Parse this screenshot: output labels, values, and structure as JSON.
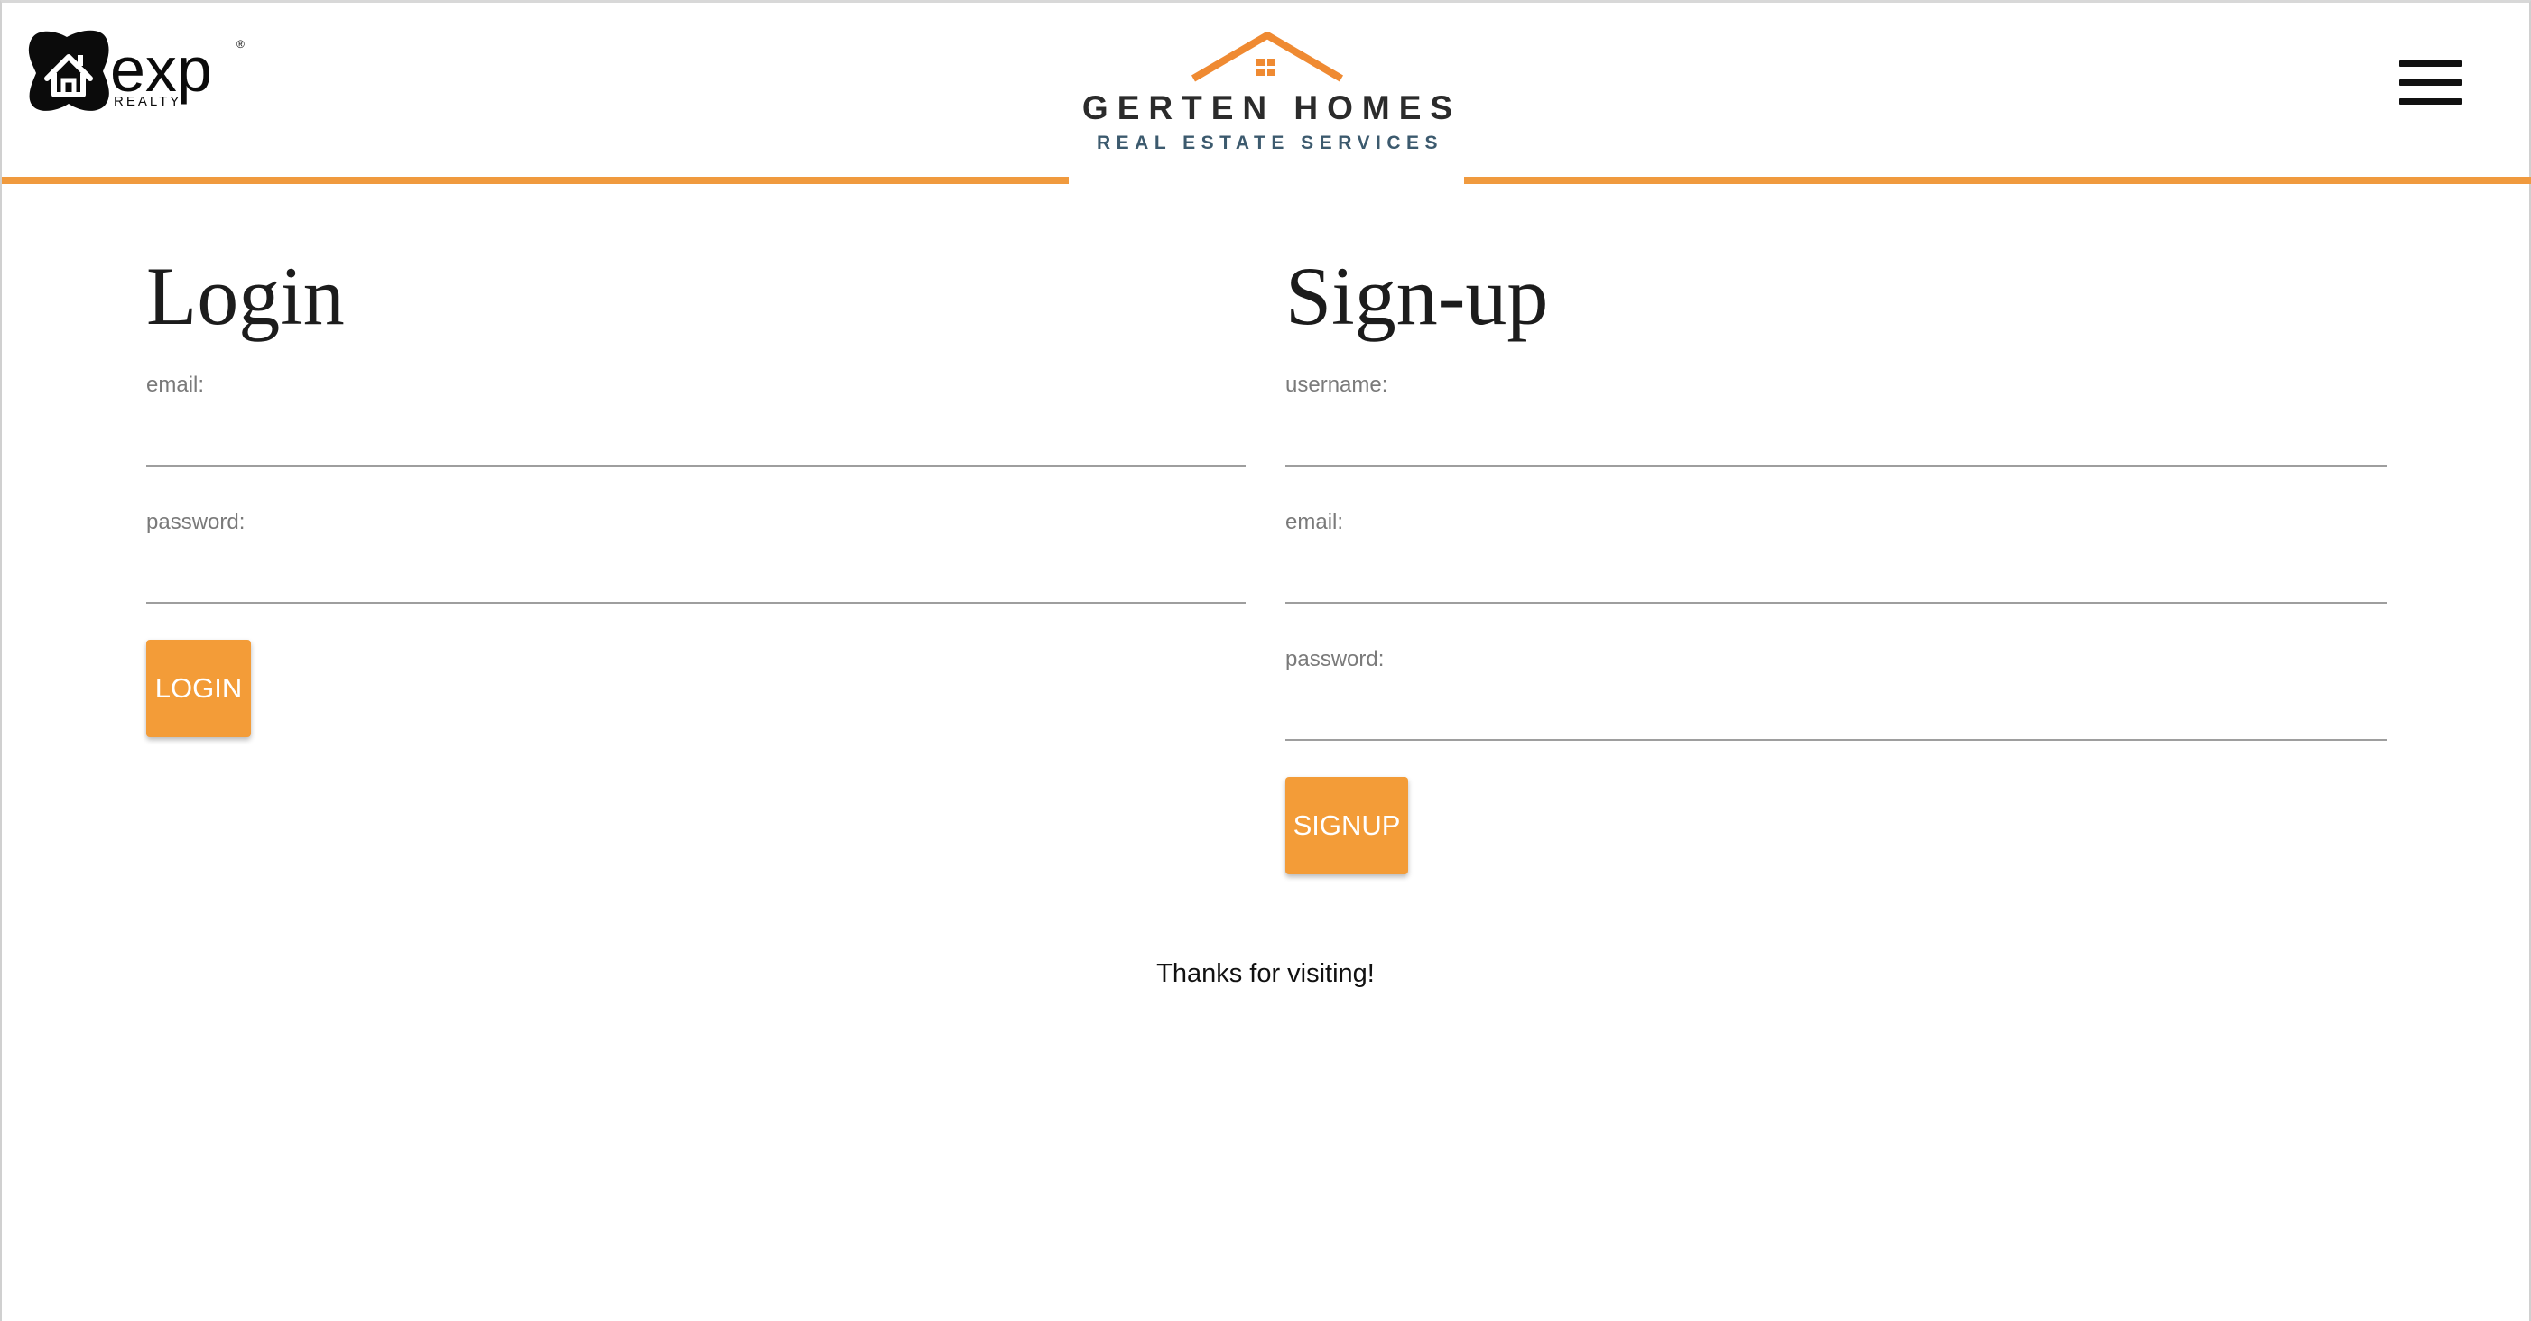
{
  "header": {
    "partner_logo": {
      "icon": "exp-realty-logo",
      "wordmark": "exp",
      "subtext": "REALTY",
      "registered": "®"
    },
    "brand": {
      "icon": "house-roof-icon",
      "name": "GERTEN HOMES",
      "tagline": "REAL ESTATE SERVICES"
    },
    "menu_icon": "hamburger-menu-icon"
  },
  "login": {
    "title": "Login",
    "fields": [
      {
        "label": "email:",
        "value": ""
      },
      {
        "label": "password:",
        "value": ""
      }
    ],
    "button_label": "LOGIN"
  },
  "signup": {
    "title": "Sign-up",
    "fields": [
      {
        "label": "username:",
        "value": ""
      },
      {
        "label": "email:",
        "value": ""
      },
      {
        "label": "password:",
        "value": ""
      }
    ],
    "button_label": "SIGNUP"
  },
  "footer": {
    "text": "Thanks for visiting!"
  },
  "colors": {
    "accent": "#f39c38",
    "rule": "#f09a3e",
    "brand_text": "#2b2b2b",
    "tagline": "#3c5a6e"
  }
}
